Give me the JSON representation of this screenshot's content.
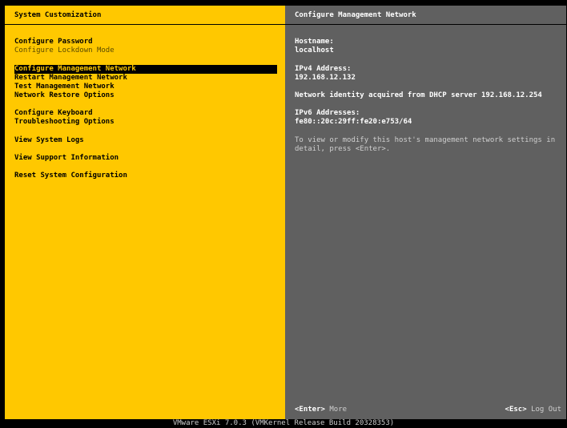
{
  "left_panel": {
    "title": "System Customization",
    "menu": [
      {
        "label": "Configure Password"
      },
      {
        "label": "Configure Lockdown Mode"
      },
      {
        "label": "Configure Management Network"
      },
      {
        "label": "Restart Management Network"
      },
      {
        "label": "Test Management Network"
      },
      {
        "label": "Network Restore Options"
      },
      {
        "label": "Configure Keyboard"
      },
      {
        "label": "Troubleshooting Options"
      },
      {
        "label": "View System Logs"
      },
      {
        "label": "View Support Information"
      },
      {
        "label": "Reset System Configuration"
      }
    ]
  },
  "right_panel": {
    "title": "Configure Management Network",
    "hostname_label": "Hostname:",
    "hostname_value": "localhost",
    "ipv4_label": "IPv4 Address:",
    "ipv4_value": "192.168.12.132",
    "dhcp_note": "Network identity acquired from DHCP server 192.168.12.254",
    "ipv6_label": "IPv6 Addresses:",
    "ipv6_value": "fe80::20c:29ff:fe20:e753/64",
    "help_text": "To view or modify this host's management network settings in detail, press <Enter>.",
    "footer": {
      "enter_key": "<Enter>",
      "enter_action": "More",
      "esc_key": "<Esc>",
      "esc_action": "Log Out"
    }
  },
  "status_bar": "VMware ESXi 7.0.3 (VMKernel Release Build 20328353)"
}
